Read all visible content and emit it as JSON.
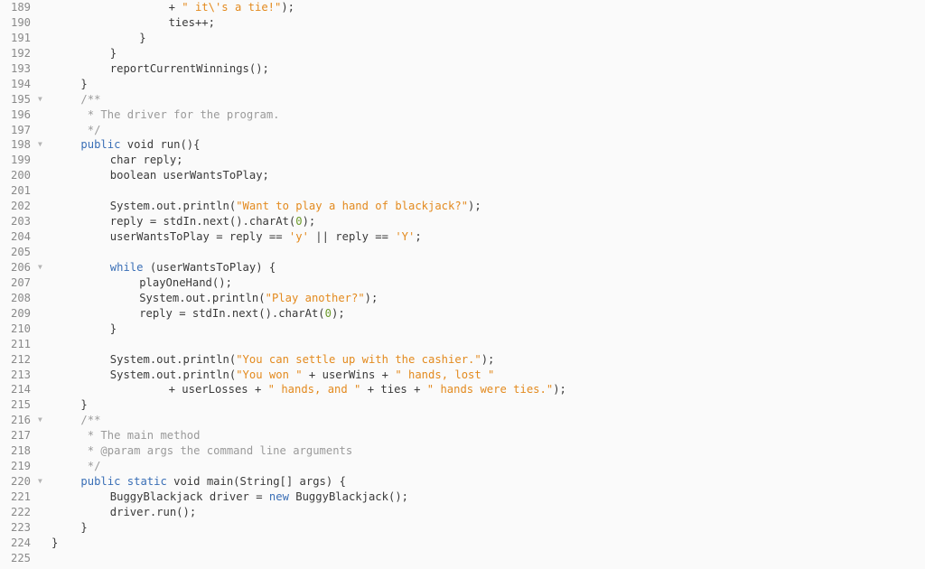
{
  "editor": {
    "language": "java",
    "colors": {
      "background": "#fafafa",
      "line_number": "#8a8a8a",
      "keyword": "#3a6fb6",
      "string": "#e38a1e",
      "number": "#6b9a2a",
      "comment": "#9a9a9a",
      "text": "#3a3a3a"
    },
    "fold_icon": "triangle-down-icon",
    "lines": [
      {
        "n": "189",
        "fold": false,
        "indent": 16,
        "tokens": [
          [
            "pl",
            "+ "
          ],
          [
            "str",
            "\" it\\'s a tie!\""
          ],
          [
            "pl",
            ");"
          ]
        ]
      },
      {
        "n": "190",
        "fold": false,
        "indent": 16,
        "tokens": [
          [
            "pl",
            "ties++;"
          ]
        ]
      },
      {
        "n": "191",
        "fold": false,
        "indent": 12,
        "tokens": [
          [
            "pl",
            "}"
          ]
        ]
      },
      {
        "n": "192",
        "fold": false,
        "indent": 8,
        "tokens": [
          [
            "pl",
            "}"
          ]
        ]
      },
      {
        "n": "193",
        "fold": false,
        "indent": 8,
        "tokens": [
          [
            "pl",
            "reportCurrentWinnings();"
          ]
        ]
      },
      {
        "n": "194",
        "fold": false,
        "indent": 4,
        "tokens": [
          [
            "pl",
            "}"
          ]
        ]
      },
      {
        "n": "195",
        "fold": true,
        "indent": 4,
        "tokens": [
          [
            "cm",
            "/**"
          ]
        ]
      },
      {
        "n": "196",
        "fold": false,
        "indent": 4,
        "tokens": [
          [
            "cm",
            " * The driver for the program."
          ]
        ]
      },
      {
        "n": "197",
        "fold": false,
        "indent": 4,
        "tokens": [
          [
            "cm",
            " */"
          ]
        ]
      },
      {
        "n": "198",
        "fold": true,
        "indent": 4,
        "tokens": [
          [
            "kw",
            "public"
          ],
          [
            "pl",
            " void run(){"
          ]
        ]
      },
      {
        "n": "199",
        "fold": false,
        "indent": 8,
        "tokens": [
          [
            "pl",
            "char reply;"
          ]
        ]
      },
      {
        "n": "200",
        "fold": false,
        "indent": 8,
        "tokens": [
          [
            "pl",
            "boolean userWantsToPlay;"
          ]
        ]
      },
      {
        "n": "201",
        "fold": false,
        "indent": 0,
        "tokens": []
      },
      {
        "n": "202",
        "fold": false,
        "indent": 8,
        "tokens": [
          [
            "pl",
            "System.out.println("
          ],
          [
            "str",
            "\"Want to play a hand of blackjack?\""
          ],
          [
            "pl",
            ");"
          ]
        ]
      },
      {
        "n": "203",
        "fold": false,
        "indent": 8,
        "tokens": [
          [
            "pl",
            "reply = stdIn.next().charAt("
          ],
          [
            "num",
            "0"
          ],
          [
            "pl",
            ");"
          ]
        ]
      },
      {
        "n": "204",
        "fold": false,
        "indent": 8,
        "tokens": [
          [
            "pl",
            "userWantsToPlay = reply == "
          ],
          [
            "str",
            "'y'"
          ],
          [
            "pl",
            " || reply == "
          ],
          [
            "str",
            "'Y'"
          ],
          [
            "pl",
            ";"
          ]
        ]
      },
      {
        "n": "205",
        "fold": false,
        "indent": 0,
        "tokens": []
      },
      {
        "n": "206",
        "fold": true,
        "indent": 8,
        "tokens": [
          [
            "kw",
            "while"
          ],
          [
            "pl",
            " (userWantsToPlay) {"
          ]
        ]
      },
      {
        "n": "207",
        "fold": false,
        "indent": 12,
        "tokens": [
          [
            "pl",
            "playOneHand();"
          ]
        ]
      },
      {
        "n": "208",
        "fold": false,
        "indent": 12,
        "tokens": [
          [
            "pl",
            "System.out.println("
          ],
          [
            "str",
            "\"Play another?\""
          ],
          [
            "pl",
            ");"
          ]
        ]
      },
      {
        "n": "209",
        "fold": false,
        "indent": 12,
        "tokens": [
          [
            "pl",
            "reply = stdIn.next().charAt("
          ],
          [
            "num",
            "0"
          ],
          [
            "pl",
            ");"
          ]
        ]
      },
      {
        "n": "210",
        "fold": false,
        "indent": 8,
        "tokens": [
          [
            "pl",
            "}"
          ]
        ]
      },
      {
        "n": "211",
        "fold": false,
        "indent": 0,
        "tokens": []
      },
      {
        "n": "212",
        "fold": false,
        "indent": 8,
        "tokens": [
          [
            "pl",
            "System.out.println("
          ],
          [
            "str",
            "\"You can settle up with the cashier.\""
          ],
          [
            "pl",
            ");"
          ]
        ]
      },
      {
        "n": "213",
        "fold": false,
        "indent": 8,
        "tokens": [
          [
            "pl",
            "System.out.println("
          ],
          [
            "str",
            "\"You won \""
          ],
          [
            "pl",
            " + userWins + "
          ],
          [
            "str",
            "\" hands, lost \""
          ]
        ]
      },
      {
        "n": "214",
        "fold": false,
        "indent": 16,
        "tokens": [
          [
            "pl",
            "+ userLosses + "
          ],
          [
            "str",
            "\" hands, and \""
          ],
          [
            "pl",
            " + ties + "
          ],
          [
            "str",
            "\" hands were ties.\""
          ],
          [
            "pl",
            ");"
          ]
        ]
      },
      {
        "n": "215",
        "fold": false,
        "indent": 4,
        "tokens": [
          [
            "pl",
            "}"
          ]
        ]
      },
      {
        "n": "216",
        "fold": true,
        "indent": 4,
        "tokens": [
          [
            "cm",
            "/**"
          ]
        ]
      },
      {
        "n": "217",
        "fold": false,
        "indent": 4,
        "tokens": [
          [
            "cm",
            " * The main method"
          ]
        ]
      },
      {
        "n": "218",
        "fold": false,
        "indent": 4,
        "tokens": [
          [
            "cm",
            " * @param args the command line arguments"
          ]
        ]
      },
      {
        "n": "219",
        "fold": false,
        "indent": 4,
        "tokens": [
          [
            "cm",
            " */"
          ]
        ]
      },
      {
        "n": "220",
        "fold": true,
        "indent": 4,
        "tokens": [
          [
            "kw",
            "public"
          ],
          [
            "pl",
            " "
          ],
          [
            "kw",
            "static"
          ],
          [
            "pl",
            " void main(String[] args) {"
          ]
        ]
      },
      {
        "n": "221",
        "fold": false,
        "indent": 8,
        "tokens": [
          [
            "pl",
            "BuggyBlackjack driver = "
          ],
          [
            "kw",
            "new"
          ],
          [
            "pl",
            " BuggyBlackjack();"
          ]
        ]
      },
      {
        "n": "222",
        "fold": false,
        "indent": 8,
        "tokens": [
          [
            "pl",
            "driver.run();"
          ]
        ]
      },
      {
        "n": "223",
        "fold": false,
        "indent": 4,
        "tokens": [
          [
            "pl",
            "}"
          ]
        ]
      },
      {
        "n": "224",
        "fold": false,
        "indent": 0,
        "tokens": [
          [
            "pl",
            "}"
          ]
        ]
      },
      {
        "n": "225",
        "fold": false,
        "indent": 0,
        "tokens": []
      }
    ]
  }
}
